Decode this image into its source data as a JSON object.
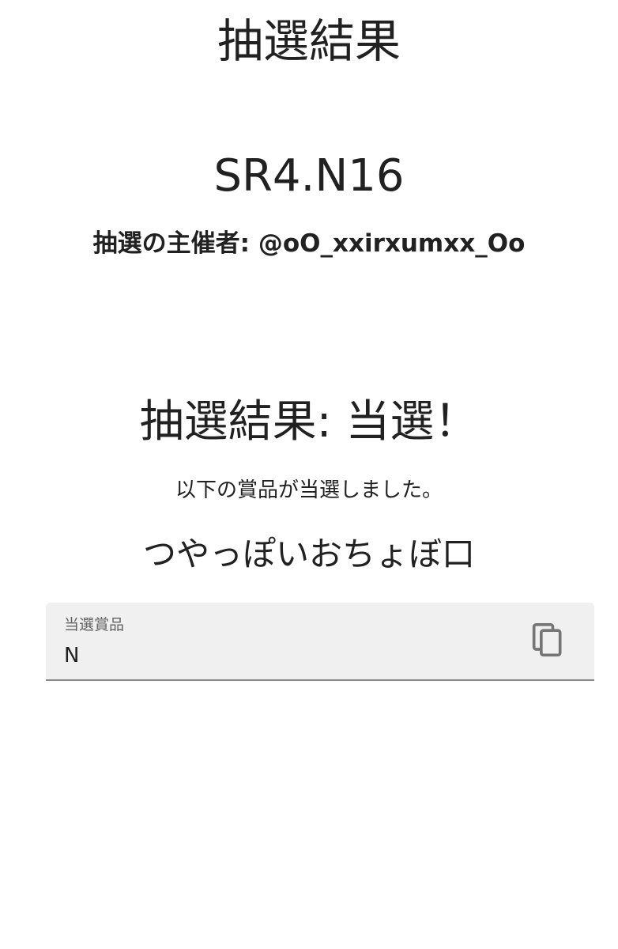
{
  "header": {
    "title": "抽選結果"
  },
  "lottery": {
    "code": "SR4.N16",
    "organizer_label": "抽選の主催者:",
    "organizer_handle": "@oO_xxirxumxx_Oo"
  },
  "result": {
    "heading": "抽選結果: 当選！",
    "message": "以下の賞品が当選しました。",
    "prize_name": "つやっぽいおちょぼ口"
  },
  "prize_field": {
    "label": "当選賞品",
    "value": "N",
    "copy_icon": "copy-icon",
    "icon_color": "#757575"
  }
}
